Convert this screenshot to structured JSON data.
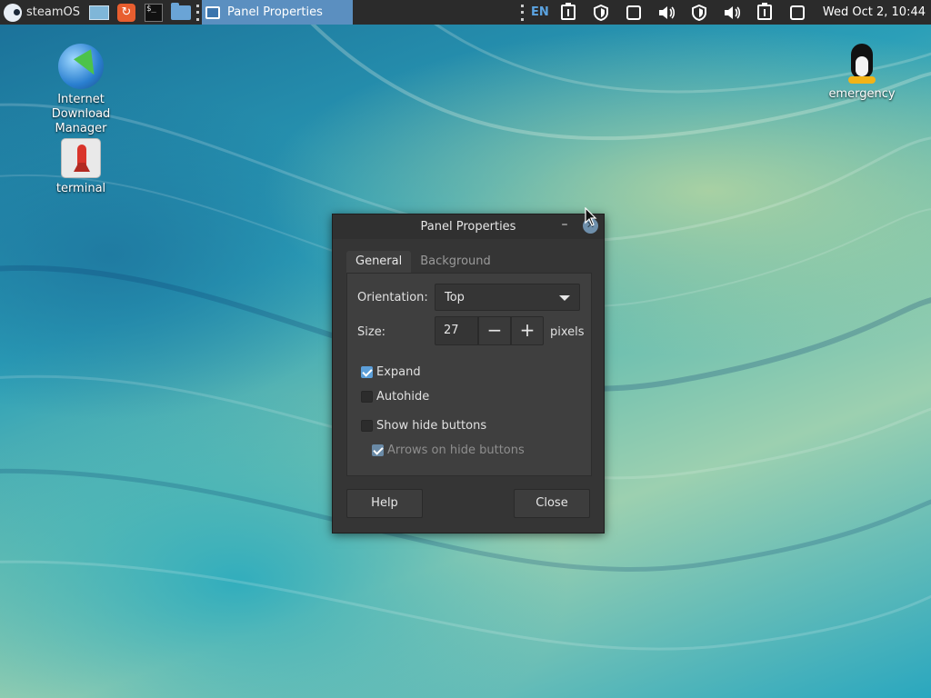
{
  "top_panel": {
    "menu_label": "steamOS",
    "launchers": [
      "desktop-icon",
      "software-icon",
      "terminal-icon",
      "folder-icon"
    ],
    "active_task": {
      "label": "Panel Properties"
    },
    "tray": {
      "language": "EN",
      "icons": [
        "clipboard-icon",
        "shield-icon",
        "window-icon",
        "volume-icon",
        "shield-icon",
        "volume-icon",
        "clipboard-icon",
        "window-icon"
      ]
    },
    "clock": "Wed Oct  2, 10:44"
  },
  "desktop": {
    "icons": [
      {
        "label": "Internet Download Manager"
      },
      {
        "label": "terminal"
      },
      {
        "label": "emergency"
      }
    ]
  },
  "dialog": {
    "title": "Panel Properties",
    "tabs": [
      {
        "label": "General",
        "active": true
      },
      {
        "label": "Background",
        "active": false
      }
    ],
    "orientation": {
      "label": "Orientation:",
      "value": "Top"
    },
    "size": {
      "label": "Size:",
      "value": "27",
      "unit": "pixels",
      "decrement": "−",
      "increment": "+"
    },
    "checkboxes": [
      {
        "label": "Expand",
        "checked": true,
        "enabled": true
      },
      {
        "label": "Autohide",
        "checked": false,
        "enabled": true
      },
      {
        "label": "Show hide buttons",
        "checked": false,
        "enabled": true
      },
      {
        "label": "Arrows on hide buttons",
        "checked": true,
        "enabled": false
      }
    ],
    "buttons": {
      "help": "Help",
      "close": "Close"
    }
  },
  "colors": {
    "panel_bg": "#2b2b2b",
    "active_task": "#5b8fc0",
    "dialog_bg": "#353535",
    "accent": "#5c9fd9"
  }
}
